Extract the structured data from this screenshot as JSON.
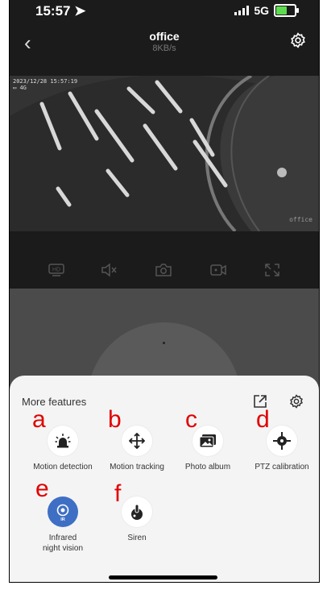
{
  "status_bar": {
    "time": "15:57",
    "network": "5G",
    "battery_level": 0.55
  },
  "header": {
    "title": "office",
    "rate": "8KB/s"
  },
  "video": {
    "timestamp": "2023/12/28 15:57:19",
    "signal": "4G",
    "watermark": "office"
  },
  "controls": [
    {
      "name": "hd",
      "label": "HD"
    },
    {
      "name": "mute"
    },
    {
      "name": "snapshot"
    },
    {
      "name": "record"
    },
    {
      "name": "fullscreen"
    }
  ],
  "sheet": {
    "title": "More features",
    "features": [
      {
        "label": "Motion detection",
        "icon": "alarm-light-icon",
        "marker": "a"
      },
      {
        "label": "Motion tracking",
        "icon": "move-arrows-icon",
        "marker": "b"
      },
      {
        "label": "Photo album",
        "icon": "photo-album-icon",
        "marker": "c"
      },
      {
        "label": "PTZ calibration",
        "icon": "crosshair-icon",
        "marker": "d"
      },
      {
        "label": "Infrared\nnight vision",
        "icon": "infrared-icon",
        "marker": "e",
        "active": true,
        "badge": "IR"
      },
      {
        "label": "Siren",
        "icon": "siren-icon",
        "marker": "f"
      }
    ]
  },
  "colors": {
    "accent": "#3e6fc4",
    "marker": "#e00000",
    "battery": "#5ddc4f"
  }
}
